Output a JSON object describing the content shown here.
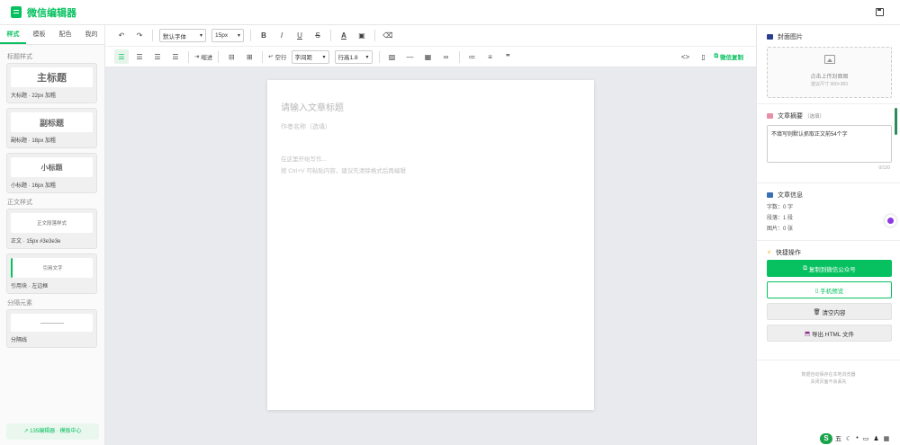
{
  "app": {
    "title": "微信编辑器"
  },
  "left": {
    "tabs": [
      "样式",
      "模板",
      "配色",
      "我的"
    ],
    "sections": {
      "title_styles": "标题样式",
      "body_styles": "正文样式",
      "divider": "分隔元素"
    },
    "cards": {
      "h1": {
        "preview": "主标题",
        "caption": "大标题 · 22px 加粗"
      },
      "h2": {
        "preview": "副标题",
        "caption": "副标题 · 18px 加粗"
      },
      "h3": {
        "preview": "小标题",
        "caption": "小标题 · 16px 加粗"
      },
      "body": {
        "preview": "正文段落样式",
        "caption": "正文 · 15px #3e3e3e"
      },
      "quote": {
        "preview": "引用文字",
        "caption": "引用块 · 左边框"
      },
      "divider": {
        "caption": "分隔线"
      }
    },
    "footer": "135编辑器 · 模板中心"
  },
  "toolbar": {
    "font_family": "默认字体",
    "font_size": "15px",
    "bold": "B",
    "italic": "I",
    "underline": "U",
    "strike": "S",
    "font_color": "A",
    "indent": "缩进",
    "empty_line": "空行",
    "letter_spacing": "字间距",
    "line_height": "行高1.8",
    "wechat_copy": "微信复制"
  },
  "editor": {
    "title_placeholder": "请输入文章标题",
    "author_placeholder": "作者名称（选填）",
    "body_line1": "在这里开始写作...",
    "body_line2": "按 Ctrl+V 可粘贴内容，建议先清除格式后再编辑"
  },
  "right": {
    "cover": {
      "title": "封面图片",
      "upload": "点击上传封面图",
      "hint": "建议尺寸 900×383"
    },
    "abstract": {
      "title": "文章摘要",
      "optional": "（选填）",
      "value": "不填写则默认抓取正文前54个字",
      "counter": "0/120"
    },
    "info": {
      "title": "文章信息",
      "words": "字数：0 字",
      "paragraphs": "段落：1 段",
      "images": "图片：0 张"
    },
    "quick": {
      "title": "快捷操作",
      "copy": "复制到微信公众号",
      "preview": "手机预览",
      "clear": "清空内容",
      "export": "导出 HTML 文件"
    },
    "footer_line1": "数据自动保存在本地浏览器",
    "footer_line2": "关闭页面不会丢失"
  },
  "ime": {
    "logo": "S",
    "label": "五"
  },
  "colors": {
    "brand": "#07c160"
  }
}
